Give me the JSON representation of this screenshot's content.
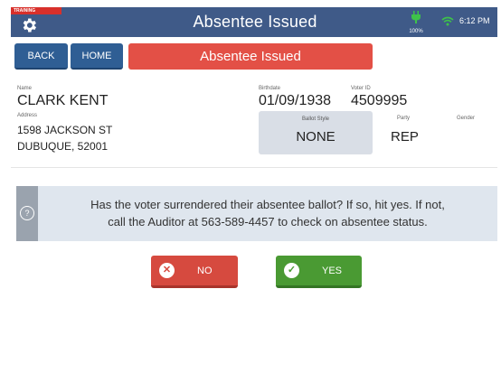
{
  "header": {
    "training_label": "TRAINING",
    "title": "Absentee Issued",
    "battery_pct": "100%",
    "time": "6:12 PM"
  },
  "nav": {
    "back_label": "BACK",
    "home_label": "HOME",
    "status_banner": "Absentee Issued"
  },
  "voter": {
    "name_label": "Name",
    "name": "CLARK KENT",
    "birthdate_label": "Birthdate",
    "birthdate": "01/09/1938",
    "voter_id_label": "Voter ID",
    "voter_id": "4509995",
    "address_label": "Address",
    "address_line1": "1598 JACKSON ST",
    "address_line2": "DUBUQUE, 52001",
    "ballot_style_label": "Ballot Style",
    "ballot_style": "NONE",
    "party_label": "Party",
    "party": "REP",
    "gender_label": "Gender",
    "gender": ""
  },
  "prompt": {
    "icon": "question-icon",
    "line1": "Has the voter surrendered their absentee ballot? If so, hit yes. If not,",
    "line2": "call the Auditor at 563-589-4457 to check on absentee status."
  },
  "actions": {
    "no_label": "NO",
    "no_icon": "close-icon",
    "yes_label": "YES",
    "yes_icon": "checkmark-icon"
  },
  "colors": {
    "header_bg": "#3f5a88",
    "nav_button": "#2f5e94",
    "banner_red": "#e35046",
    "no_red": "#d64a3f",
    "yes_green": "#4a9a33",
    "battery_green": "#3ec24a"
  }
}
